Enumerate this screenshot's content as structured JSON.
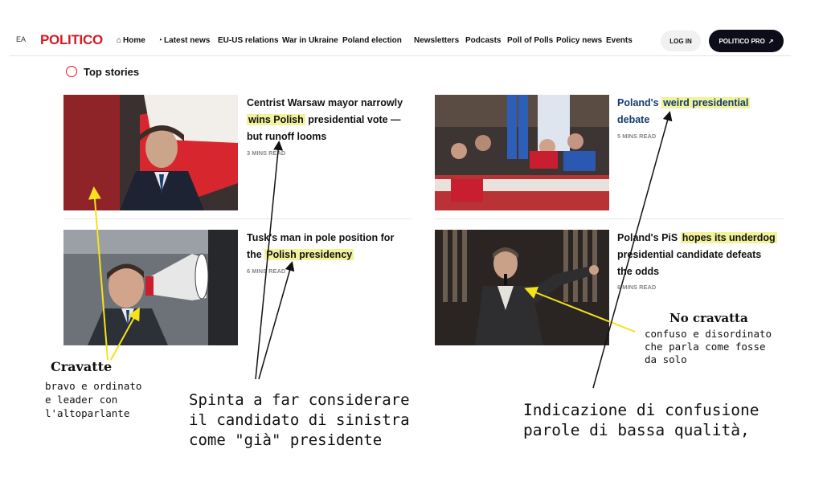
{
  "nav": {
    "edge_text": "EA",
    "logo": "POLITICO",
    "items": [
      {
        "label": "Home",
        "icon": "home-icon"
      },
      {
        "label": "Latest news",
        "icon": "clock-icon"
      },
      {
        "label": "EU-US relations"
      },
      {
        "label": "War in Ukraine"
      },
      {
        "label": "Poland election"
      },
      {
        "label": "Newsletters"
      },
      {
        "label": "Podcasts"
      },
      {
        "label": "Poll of Polls"
      },
      {
        "label": "Policy news"
      },
      {
        "label": "Events"
      }
    ],
    "login": "LOG IN",
    "pro": "POLITICO PRO"
  },
  "section_title": "Top stories",
  "stories": [
    {
      "h1": "Centrist Warsaw mayor narrowly",
      "h2a": "wins Polish",
      "h2b": " presidential vote —",
      "h3": "but runoff looms",
      "meta": "3 MINS READ"
    },
    {
      "h1a": "Poland's ",
      "h1b": "weird presidential",
      "h2": "debate",
      "meta": "5 MINS READ"
    },
    {
      "h1": "Tusk's man in pole position for",
      "h2a": "the ",
      "h2b": "Polish presidency",
      "meta": "6 MINS READ"
    },
    {
      "h1a": "Poland's PiS ",
      "h1b": "hopes its underdog",
      "h2": "presidential candidate defeats",
      "h3": "the odds",
      "meta": "6 MINS READ"
    }
  ],
  "annotations": {
    "cravatte_title": "Cravatte",
    "cravatte_text": "bravo e ordinato\ne leader con\nl'altoparlante",
    "spinta_text": "Spinta a far considerare\nil candidato di sinistra\ncome \"già\" presidente",
    "nocravatta_title": "No cravatta",
    "nocravatta_text": "confuso e disordinato\nche parla come fosse\nda solo",
    "confusione_text": "Indicazione di confusione\nparole di bassa qualità,"
  },
  "colors": {
    "brand": "#d71920",
    "highlight": "#f2f29a",
    "headline_blue": "#123b6d",
    "arrow_yellow": "#f5e21a"
  }
}
